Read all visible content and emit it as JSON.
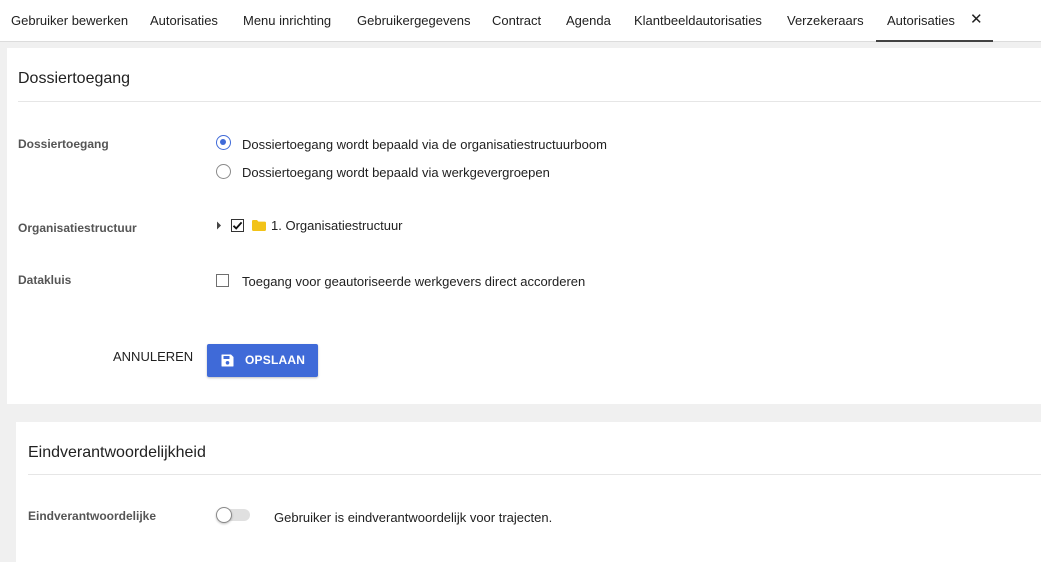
{
  "tabs": [
    {
      "label": "Gebruiker bewerken"
    },
    {
      "label": "Autorisaties"
    },
    {
      "label": "Menu inrichting"
    },
    {
      "label": "Gebruikergegevens"
    },
    {
      "label": "Contract"
    },
    {
      "label": "Agenda"
    },
    {
      "label": "Klantbeeldautorisaties"
    },
    {
      "label": "Verzekeraars"
    },
    {
      "label": "Autorisaties",
      "active": true
    }
  ],
  "tab_close_icon": "close-icon",
  "dossiertoegang": {
    "title": "Dossiertoegang",
    "access_label": "Dossiertoegang",
    "options": [
      {
        "label": "Dossiertoegang wordt bepaald via de organisatiestructuurboom",
        "selected": true
      },
      {
        "label": "Dossiertoegang wordt bepaald via werkgevergroepen",
        "selected": false
      }
    ],
    "org_label": "Organisatiestructuur",
    "org_tree": {
      "label": "1. Organisatiestructuur",
      "checked": true,
      "expanded": false
    },
    "datakluis_label": "Datakluis",
    "datakluis_option": {
      "label": "Toegang voor geautoriseerde werkgevers direct accorderen",
      "checked": false
    },
    "cancel_label": "ANNULEREN",
    "save_label": "OPSLAAN"
  },
  "eindverantwoordelijkheid": {
    "title": "Eindverantwoordelijkheid",
    "field_label": "Eindverantwoordelijke",
    "toggle_on": false,
    "toggle_text": "Gebruiker is eindverantwoordelijk voor trajecten."
  },
  "colors": {
    "accent": "#3f6ad8",
    "folder": "#f2c318",
    "background": "#f0f0f0",
    "card": "#ffffff"
  }
}
